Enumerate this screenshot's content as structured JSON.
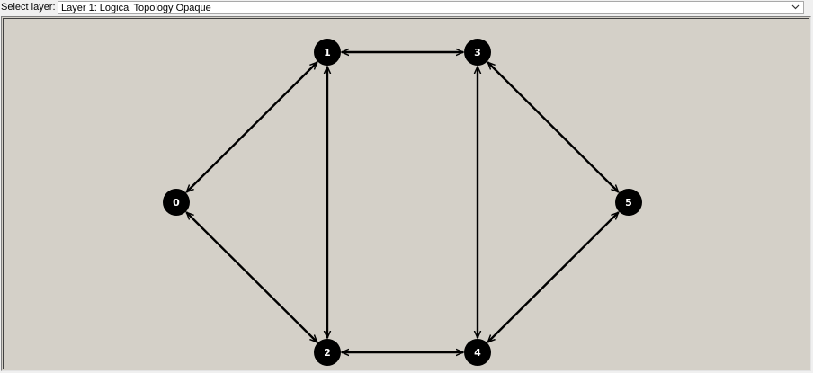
{
  "layer_selector": {
    "label": "Select layer:",
    "selected": "Layer  1: Logical Topology Opaque",
    "dropdown_icon": "chevron-down-icon"
  },
  "topology": {
    "colors": {
      "canvas": "#d4d0c8",
      "node": "#000000",
      "node_text": "#ffffff",
      "link": "#000000"
    },
    "nodes": [
      {
        "id": "0",
        "label": "0"
      },
      {
        "id": "1",
        "label": "1"
      },
      {
        "id": "2",
        "label": "2"
      },
      {
        "id": "3",
        "label": "3"
      },
      {
        "id": "4",
        "label": "4"
      },
      {
        "id": "5",
        "label": "5"
      }
    ],
    "links": [
      {
        "source": "0",
        "target": "1",
        "bidirectional": true
      },
      {
        "source": "0",
        "target": "2",
        "bidirectional": true
      },
      {
        "source": "1",
        "target": "2",
        "bidirectional": true
      },
      {
        "source": "1",
        "target": "3",
        "bidirectional": true
      },
      {
        "source": "2",
        "target": "4",
        "bidirectional": true
      },
      {
        "source": "3",
        "target": "4",
        "bidirectional": true
      },
      {
        "source": "3",
        "target": "5",
        "bidirectional": true
      },
      {
        "source": "4",
        "target": "5",
        "bidirectional": true
      }
    ]
  }
}
